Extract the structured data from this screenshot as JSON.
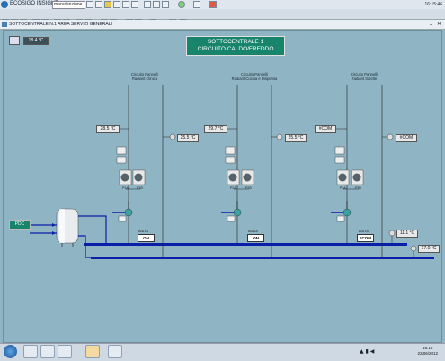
{
  "appbar": {
    "title": "ECOSIGO INSIGHT",
    "user_field": "manutenzione",
    "time": "16:15:46"
  },
  "window": {
    "title": "SOTTOCENTRALE N.1 AREA SERVIZI GENERALI"
  },
  "outdoor_temp": "18.4 °C",
  "main_title": {
    "line1": "SOTTOCENTRALE 1",
    "line2": "CIRCUITO CALDO/FREDDO"
  },
  "circuits": [
    {
      "label1": "Circuito Pannelli",
      "label2": "Radiant Clinica",
      "supply_temp": "28.5 °C",
      "return_temp": "25.5 °C",
      "pump_a": "P1A",
      "pump_b": "P1B",
      "aiuta": "AIUTA",
      "state": "ON"
    },
    {
      "label1": "Circuito Pannelli",
      "label2": "Radiant Cucina e Dispensa",
      "supply_temp": "29.7 °C",
      "return_temp": "25.5 °C",
      "pump_a": "P2A",
      "pump_b": "P2B",
      "aiuta": "AIUTA",
      "state": "ON"
    },
    {
      "label1": "Circuito Pannelli",
      "label2": "Radiant Salette",
      "supply_temp": "#COM",
      "return_temp": "#COM",
      "pump_a": "P3A",
      "pump_b": "P3B",
      "aiuta": "AIUTA",
      "state": "#COM"
    }
  ],
  "manifold_temp_1": "11.1 °C",
  "manifold_temp_2": "17.0 °C",
  "pdc_label": "PDC",
  "taskbar": {
    "time": "16:15",
    "date": "22/06/2012"
  },
  "colors": {
    "background": "#8fb4c4",
    "pipe_blue": "#0a1fa8",
    "accent_green": "#17846b"
  }
}
